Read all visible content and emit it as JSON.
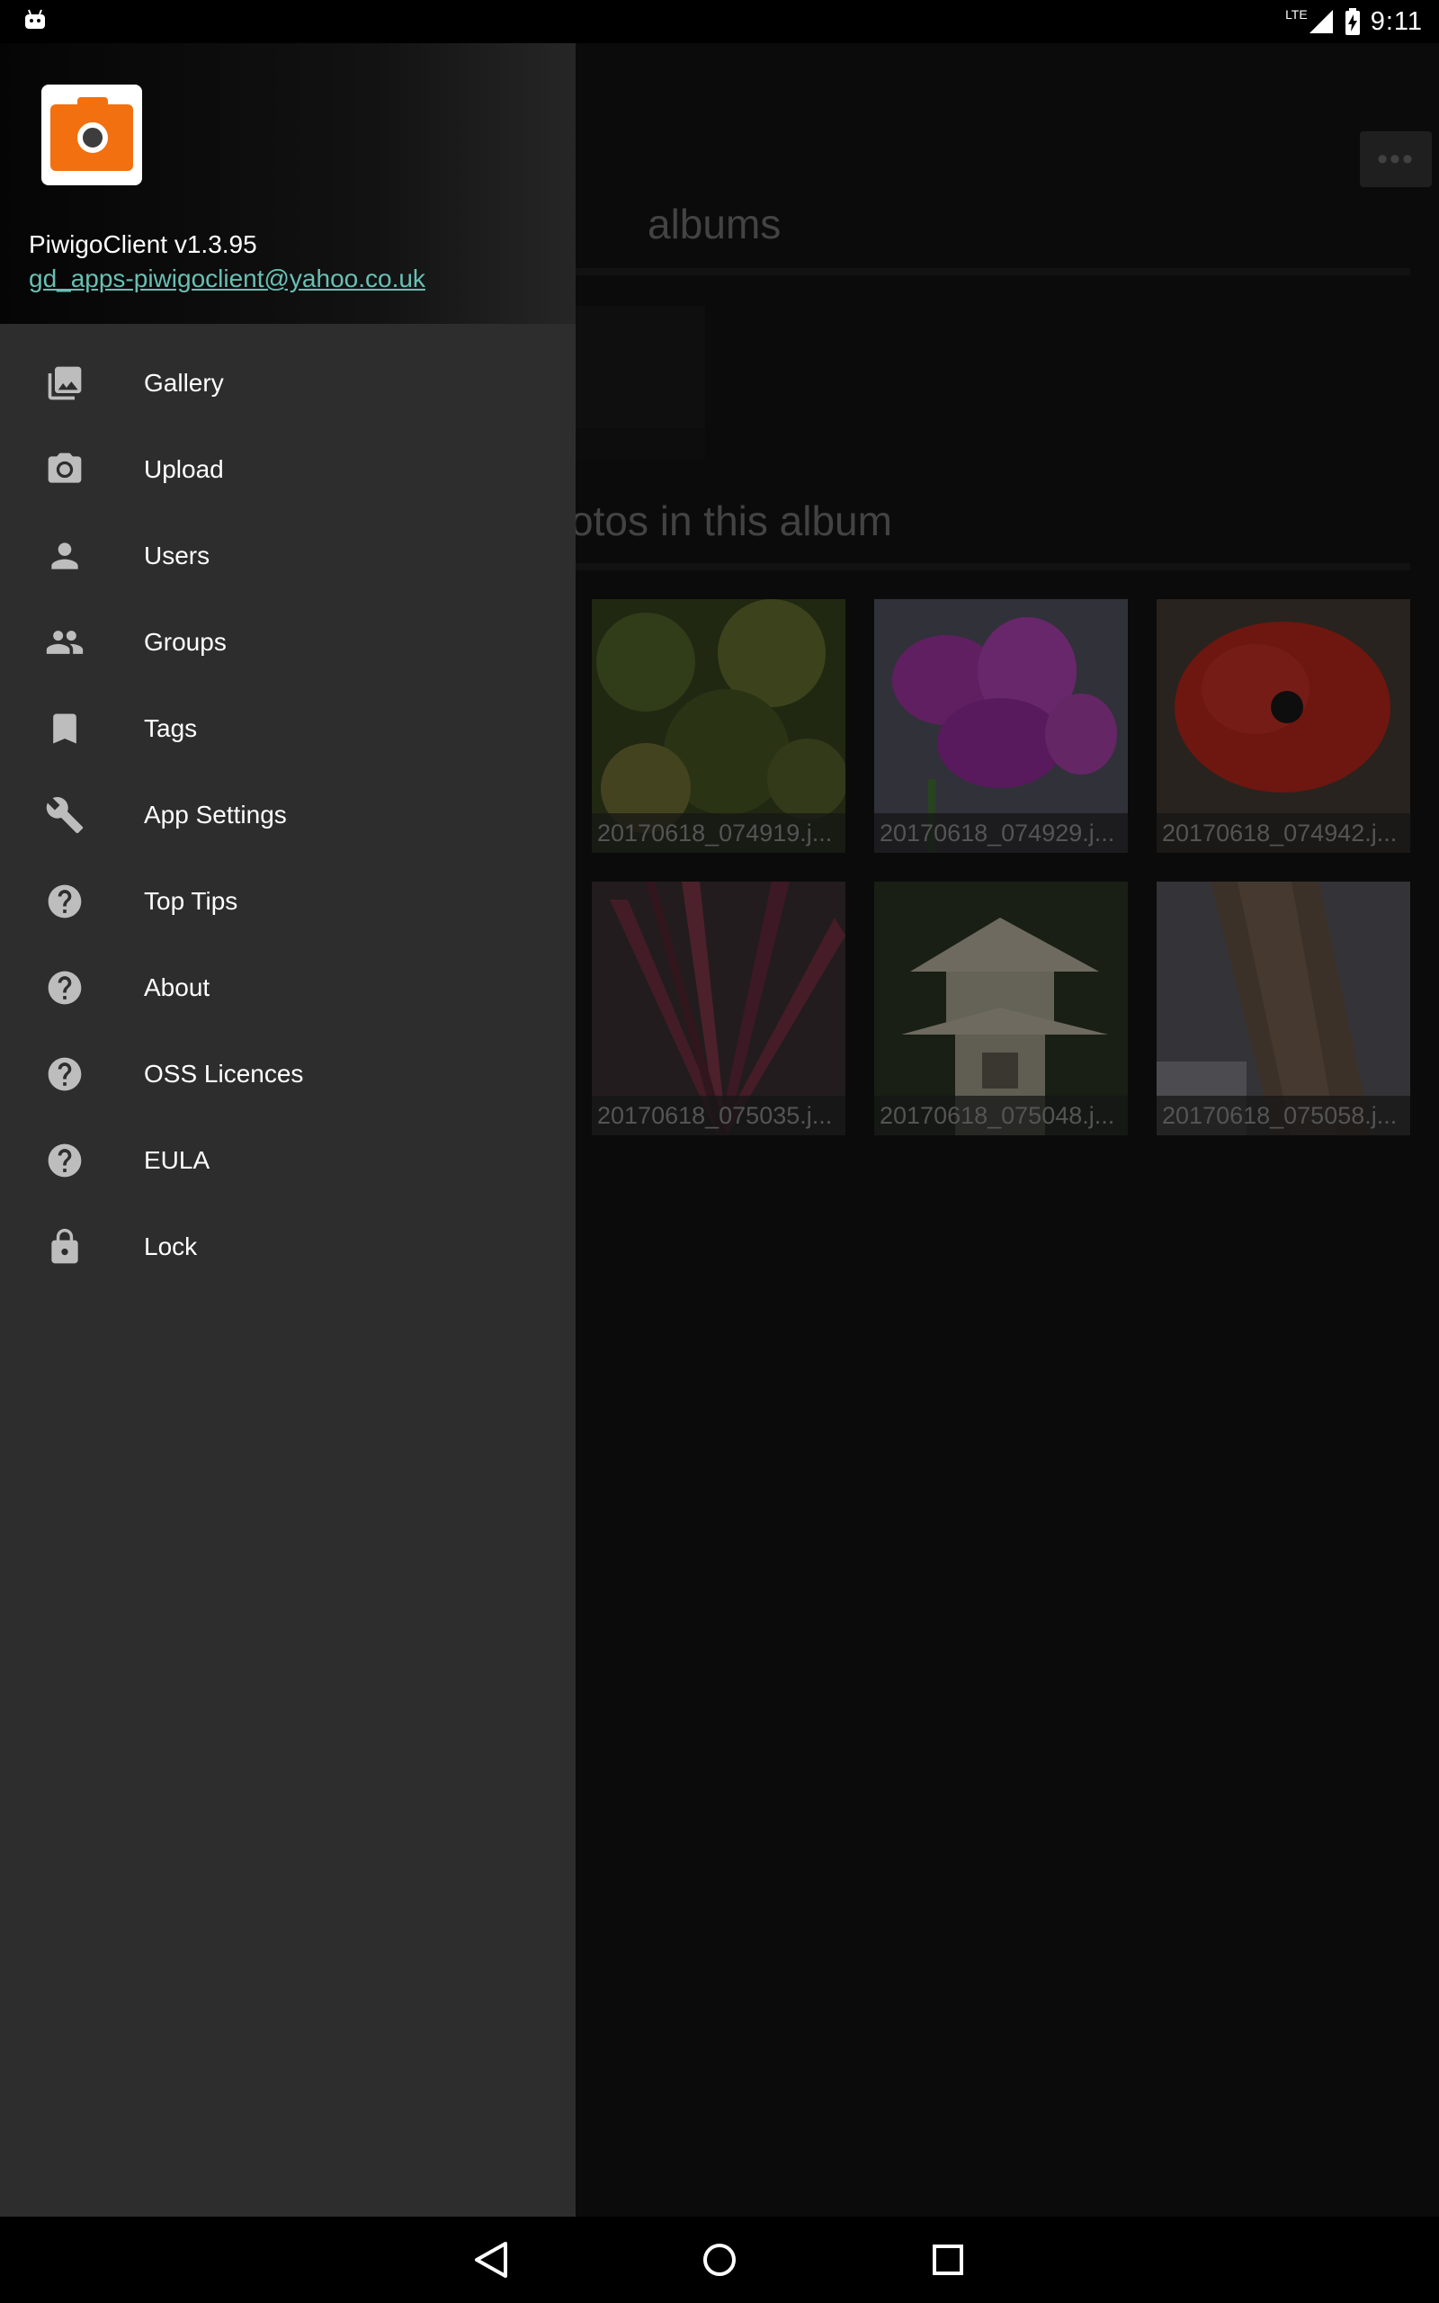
{
  "status_bar": {
    "network": "LTE",
    "time": "9:11"
  },
  "drawer": {
    "app_name": "PiwigoClient v1.3.95",
    "email": "gd_apps-piwigoclient@yahoo.co.uk",
    "items": [
      {
        "label": "Gallery",
        "icon": "gallery-icon"
      },
      {
        "label": "Upload",
        "icon": "camera-icon"
      },
      {
        "label": "Users",
        "icon": "person-icon"
      },
      {
        "label": "Groups",
        "icon": "group-icon"
      },
      {
        "label": "Tags",
        "icon": "bookmark-icon"
      },
      {
        "label": "App Settings",
        "icon": "wrench-icon"
      },
      {
        "label": "Top Tips",
        "icon": "help-icon"
      },
      {
        "label": "About",
        "icon": "help-icon"
      },
      {
        "label": "OSS Licences",
        "icon": "help-icon"
      },
      {
        "label": "EULA",
        "icon": "help-icon"
      },
      {
        "label": "Lock",
        "icon": "lock-icon"
      }
    ]
  },
  "main": {
    "albums_heading": "albums",
    "photos_heading": "otos in this album",
    "more_label": "•••",
    "photos": [
      {
        "caption": "20170618_074919.j..."
      },
      {
        "caption": "20170618_074929.j..."
      },
      {
        "caption": "20170618_074942.j..."
      },
      {
        "caption": "20170618_075035.j..."
      },
      {
        "caption": "20170618_075048.j..."
      },
      {
        "caption": "20170618_075058.j..."
      }
    ]
  },
  "colors": {
    "accent_orange": "#f2700f",
    "link_teal": "#68c0b4",
    "drawer_bg": "#2d2d2d"
  }
}
